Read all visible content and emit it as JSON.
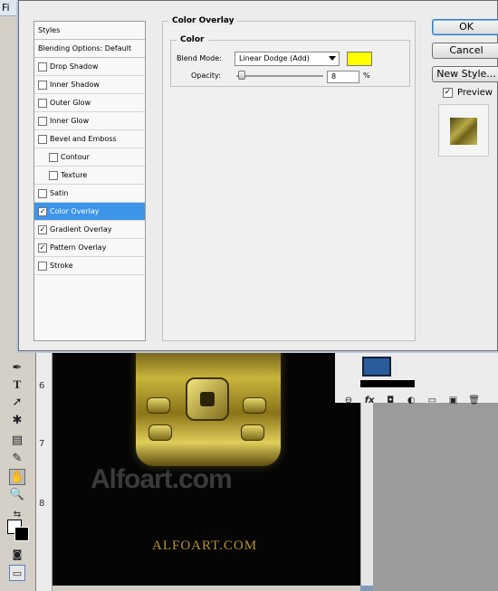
{
  "dialog": {
    "styles_list": {
      "header": "Styles",
      "blending_options": "Blending Options: Default",
      "items": [
        {
          "label": "Drop Shadow",
          "checked": false,
          "indent": false,
          "active": false
        },
        {
          "label": "Inner Shadow",
          "checked": false,
          "indent": false,
          "active": false
        },
        {
          "label": "Outer Glow",
          "checked": false,
          "indent": false,
          "active": false
        },
        {
          "label": "Inner Glow",
          "checked": false,
          "indent": false,
          "active": false
        },
        {
          "label": "Bevel and Emboss",
          "checked": false,
          "indent": false,
          "active": false
        },
        {
          "label": "Contour",
          "checked": false,
          "indent": true,
          "active": false
        },
        {
          "label": "Texture",
          "checked": false,
          "indent": true,
          "active": false
        },
        {
          "label": "Satin",
          "checked": false,
          "indent": false,
          "active": false
        },
        {
          "label": "Color Overlay",
          "checked": true,
          "indent": false,
          "active": true
        },
        {
          "label": "Gradient Overlay",
          "checked": true,
          "indent": false,
          "active": false
        },
        {
          "label": "Pattern Overlay",
          "checked": true,
          "indent": false,
          "active": false
        },
        {
          "label": "Stroke",
          "checked": false,
          "indent": false,
          "active": false
        }
      ]
    },
    "panel": {
      "group_title": "Color Overlay",
      "sub_title": "Color",
      "blend_mode_label": "Blend Mode:",
      "blend_mode_value": "Linear Dodge (Add)",
      "overlay_color": "#ffff00",
      "opacity_label": "Opacity:",
      "opacity_value": "8",
      "opacity_unit": "%"
    },
    "buttons": {
      "ok": "OK",
      "cancel": "Cancel",
      "new_style": "New Style..."
    },
    "preview": {
      "label": "Preview",
      "checked": true
    }
  },
  "canvas": {
    "ruler_ticks": [
      "6",
      "7",
      "8"
    ],
    "watermark_large": "Alfoart.com",
    "watermark_small": "ALFOART.COM"
  },
  "colors": {
    "selection": "#3d95ea",
    "canvas_bg": "#050505"
  }
}
